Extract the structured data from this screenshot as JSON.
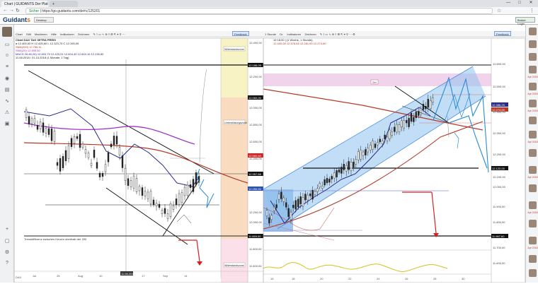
{
  "browser": {
    "tab_active": "Chart | GUIDANTS Der Plattform",
    "tab_new": "+",
    "window_controls": [
      "—",
      "□",
      "✕"
    ],
    "url_secure_label": "Sicher",
    "url": "https://go.guidants.com/de#c/125201"
  },
  "app": {
    "logo_main": "Guidant",
    "logo_suffix": "s",
    "header_button": "Desktop",
    "header_right_button": "Broker Login",
    "right_rail_labels": [
      "Apr\n2018",
      "Apr\n2018",
      "Apr\n2018",
      "Apr\n2018",
      "Apr\n2018",
      "Apr\n2018",
      "Apr\n2018"
    ]
  },
  "left_chart": {
    "toolbar": [
      "Chart",
      "Stift",
      "Markieren",
      "Hilfe",
      "Indikatoren",
      "Zeichnen"
    ],
    "toolbar_button": "Feedback",
    "title": "Chart DAX TAG XETRA PREIS",
    "info_lines": [
      "⌀ 12.400,00  H 12.425,60  L 12.123,70  C 12.193,00",
      "SMA(200)  12.756,11",
      "SMA(20)  12.595,50",
      "MACD 26,60,26)  12.603,75  12.420,01  12.604,40  12.604,16  12.228,80",
      "11.08.2018 / 31.10.2018 (1 Monate, 1 Tag)"
    ],
    "price_labels": [
      "12.400,00",
      "12.200,00",
      "12.000,00",
      "12.800,00",
      "12.600,00",
      "12.400,00",
      "12.200,00",
      "12.000,00",
      "11.800,00",
      "11.600,00"
    ],
    "value_tags": [
      "12.186,09",
      "12.060,00",
      "12.560,60",
      "12.357,66",
      "12.250,50",
      "11.869,00"
    ],
    "zone_labels": [
      "Widerstandszone",
      "Unterstützungszone",
      "Widerstandszone"
    ],
    "bottom_note": "Trenddifferenz zwischen Kerzen oberhalb der 200",
    "date_label": "11.08.2018",
    "x_axis_labels": [
      "Jul",
      "25",
      "Aug",
      "10",
      "17",
      "Sep",
      "14"
    ]
  },
  "right_chart": {
    "toolbar": [
      "1 Stunde",
      "Dr.",
      "Indikatoren",
      "Zeichnen"
    ],
    "toolbar_button": "Feedback",
    "info_lines": [
      "19 18:00 | (1 Woche, 1 Stunde)",
      "12.400,00  12.576,65  12.281,90  12.274,60"
    ],
    "price_labels": [
      "12.600,00",
      "12.500,00",
      "12.400,00",
      "12.300,00",
      "12.200,00",
      "12.100,00",
      "12.000,00",
      "11.900,00",
      "11.800,00",
      "11.700,00",
      "11.600,00"
    ],
    "value_tags": [
      "12.386,25",
      "12.274,65",
      "12.122,00",
      "11.967,60"
    ],
    "box_label": "Ziel",
    "x_axis_labels": [
      "16",
      "18",
      "20",
      "22",
      "24",
      "26",
      "28",
      "30"
    ]
  }
}
